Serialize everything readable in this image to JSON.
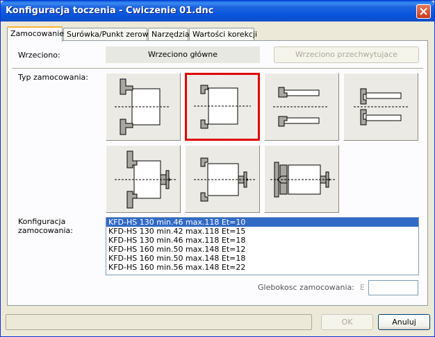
{
  "window": {
    "title": "Konfiguracja toczenia - Cwiczenie 01.dnc",
    "close_icon": "close-icon"
  },
  "tabs": [
    {
      "label": "Zamocowanie",
      "active": true
    },
    {
      "label": "Surówka/Punkt zerowy",
      "active": false
    },
    {
      "label": "Narzędzia",
      "active": false
    },
    {
      "label": "Wartości korekcji",
      "active": false
    }
  ],
  "spindle": {
    "label": "Wrzeciono:",
    "main_label": "Wrzeciono główne",
    "sub_label": "Wrzeciono przechwytujace"
  },
  "clamping_type": {
    "label": "Typ zamocowania:",
    "selected_index": 1,
    "options": [
      "chuck-outer-jaws-icon",
      "chuck-inner-jaws-icon",
      "chuck-bar-icon",
      "chuck-bar-inner-icon",
      "chuck-tailstock-icon",
      "chuck-tailstock-small-icon",
      "between-centers-icon"
    ]
  },
  "clamping_config": {
    "label_line1": "Konfiguracja",
    "label_line2": "zamocowania:",
    "items": [
      "KFD-HS 130 min.46 max.118 Et=10",
      "KFD-HS 130 min.42 max.118 Et=15",
      "KFD-HS 130 min.46 max.118 Et=18",
      "KFD-HS 160 min.50 max.148 Et=12",
      "KFD-HS 160 min.50 max.148 Et=18",
      "KFD-HS 160 min.56 max.148 Et=22"
    ],
    "selected_index": 0
  },
  "depth": {
    "label": "Glebokosc zamocowania:",
    "prefix": "E",
    "value": ""
  },
  "buttons": {
    "ok": "OK",
    "cancel": "Anuluj"
  },
  "colors": {
    "titlebar": "#0a5fd8",
    "selection": "#316ac5",
    "selected_border": "#e00000",
    "jaw": "#a8a8a0"
  }
}
